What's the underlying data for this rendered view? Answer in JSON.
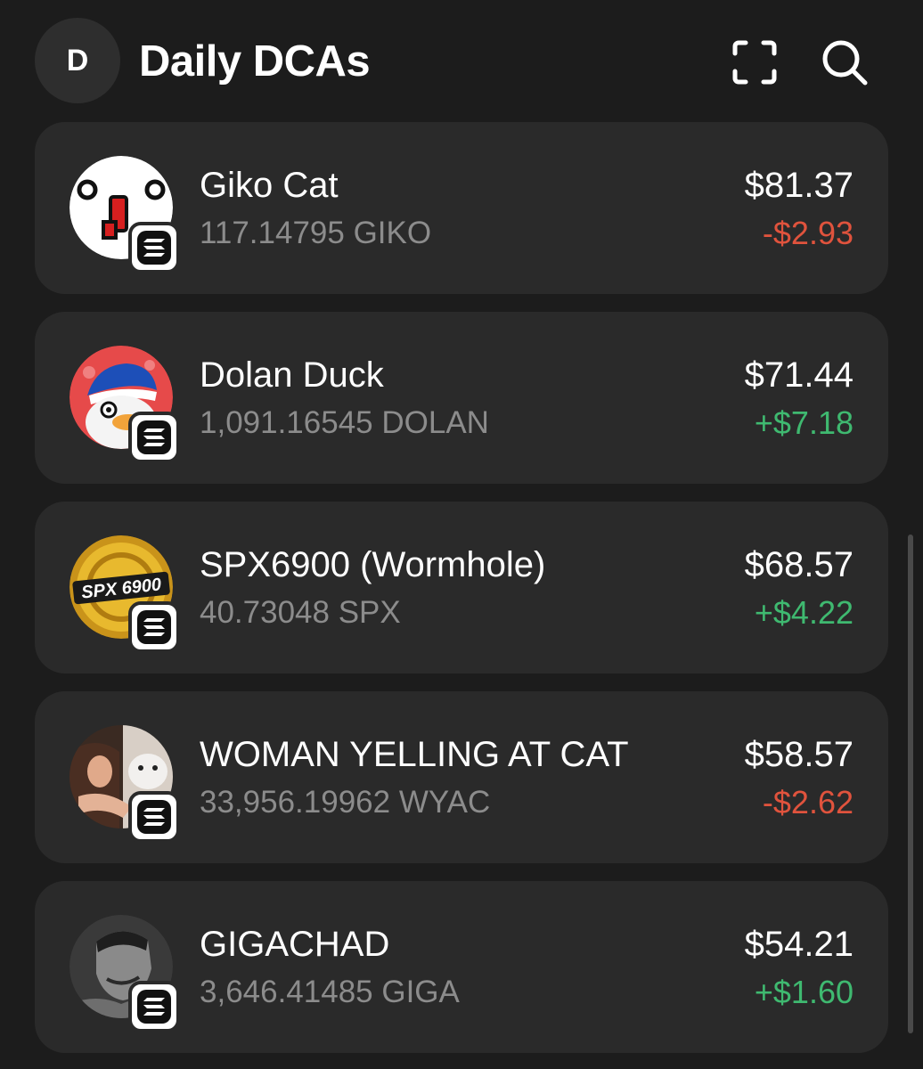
{
  "header": {
    "avatar_letter": "D",
    "title": "Daily DCAs",
    "scan_icon": "scan-frame-icon",
    "search_icon": "search-icon"
  },
  "colors": {
    "background": "#1c1c1c",
    "card": "#2a2a2a",
    "negative": "#e0533d",
    "positive": "#3fb970",
    "muted_text": "#8c8c8c"
  },
  "tokens": [
    {
      "name": "Giko Cat",
      "amount": "117.14795 GIKO",
      "value": "$81.37",
      "change": "-$2.93",
      "direction": "negative",
      "logo_icon": "giko-cat-logo-icon"
    },
    {
      "name": "Dolan Duck",
      "amount": "1,091.16545 DOLAN",
      "value": "$71.44",
      "change": "+$7.18",
      "direction": "positive",
      "logo_icon": "dolan-duck-logo-icon"
    },
    {
      "name": "SPX6900 (Wormhole)",
      "amount": "40.73048 SPX",
      "value": "$68.57",
      "change": "+$4.22",
      "direction": "positive",
      "logo_icon": "spx6900-logo-icon",
      "logo_text": "SPX 6900"
    },
    {
      "name": "WOMAN YELLING AT CAT",
      "amount": "33,956.19962 WYAC",
      "value": "$58.57",
      "change": "-$2.62",
      "direction": "negative",
      "logo_icon": "woman-yelling-at-cat-logo-icon"
    },
    {
      "name": "GIGACHAD",
      "amount": "3,646.41485 GIGA",
      "value": "$54.21",
      "change": "+$1.60",
      "direction": "positive",
      "logo_icon": "gigachad-logo-icon"
    }
  ],
  "chain_badge_icon": "solana-icon"
}
